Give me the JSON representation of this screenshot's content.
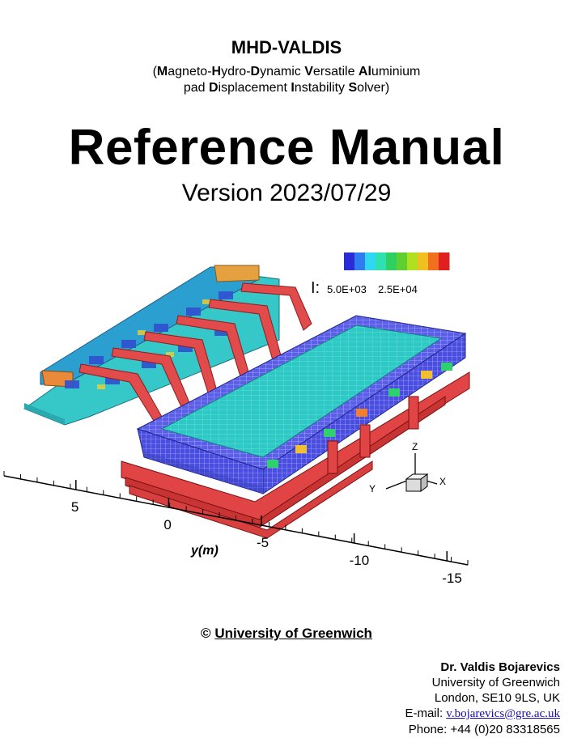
{
  "header": {
    "title": "MHD-VALDIS",
    "subtitle_line1": [
      {
        "text": "(",
        "bold": false
      },
      {
        "text": "M",
        "bold": true
      },
      {
        "text": "agneto-",
        "bold": false
      },
      {
        "text": "H",
        "bold": true
      },
      {
        "text": "ydro-",
        "bold": false
      },
      {
        "text": "D",
        "bold": true
      },
      {
        "text": "ynamic ",
        "bold": false
      },
      {
        "text": "V",
        "bold": true
      },
      {
        "text": "ersatile ",
        "bold": false
      },
      {
        "text": "Al",
        "bold": true
      },
      {
        "text": "uminium",
        "bold": false
      }
    ],
    "subtitle_line2": [
      {
        "text": "pad ",
        "bold": false
      },
      {
        "text": "D",
        "bold": true
      },
      {
        "text": "isplacement ",
        "bold": false
      },
      {
        "text": "I",
        "bold": true
      },
      {
        "text": "nstability ",
        "bold": false
      },
      {
        "text": "S",
        "bold": true
      },
      {
        "text": "olver)",
        "bold": false
      }
    ],
    "main_title": "Reference Manual",
    "version": "Version 2023/07/29"
  },
  "figure": {
    "legend": {
      "variable": "I:",
      "min_label": "5.0E+03",
      "max_label": "2.5E+04",
      "colors": [
        "#2b2bd8",
        "#2f7bf0",
        "#2fd7f0",
        "#2fe0b0",
        "#2fd060",
        "#60d030",
        "#b0e020",
        "#f0c020",
        "#f07020",
        "#e02020"
      ]
    },
    "axis": {
      "label": "y(m)",
      "ticks": [
        "5",
        "0",
        "-5",
        "-10",
        "-15"
      ]
    },
    "triad": {
      "z": "Z",
      "y": "Y",
      "x": "X"
    }
  },
  "footer": {
    "copyright_symbol": "©",
    "copyright_org": "University of Greenwich",
    "contact": {
      "name": "Dr. Valdis Bojarevics",
      "org": "University of Greenwich",
      "address": "London, SE10 9LS, UK",
      "email_label": "E-mail:",
      "email": "v.bojarevics@gre.ac.uk",
      "phone": "Phone: +44 (0)20 83318565"
    }
  }
}
